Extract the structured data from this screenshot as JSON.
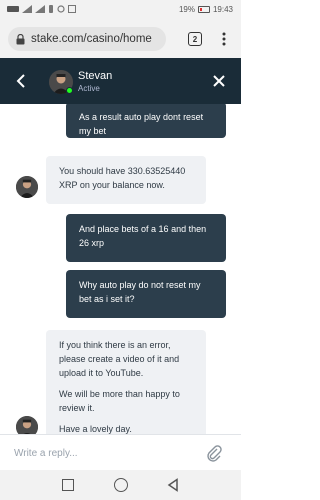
{
  "status_bar": {
    "battery": "19%",
    "time": "19:43"
  },
  "browser": {
    "url": "stake.com/casino/home",
    "tab_count": "2"
  },
  "chat": {
    "agent_name": "Stevan",
    "agent_status": "Active",
    "messages": [
      {
        "from": "user",
        "text": "As a result auto play dont reset my bet"
      },
      {
        "from": "agent",
        "paragraphs": [
          "You should have 330.63525440 XRP on your balance now."
        ]
      },
      {
        "from": "user",
        "text": "And place bets of a 16 and then 26 xrp"
      },
      {
        "from": "user",
        "text": "Why auto play do not reset my bet as i set it?"
      },
      {
        "from": "agent",
        "paragraphs": [
          "If you think there is an error, please create a video of it and upload it to YouTube.",
          "We will be more than happy to review it.",
          "Have a lovely day."
        ]
      }
    ],
    "composer_placeholder": "Write a reply..."
  },
  "colors": {
    "header_bg": "#1a2c38",
    "user_bubble": "#2c3e4c",
    "agent_bubble": "#eff1f4",
    "online": "#1fff20"
  }
}
